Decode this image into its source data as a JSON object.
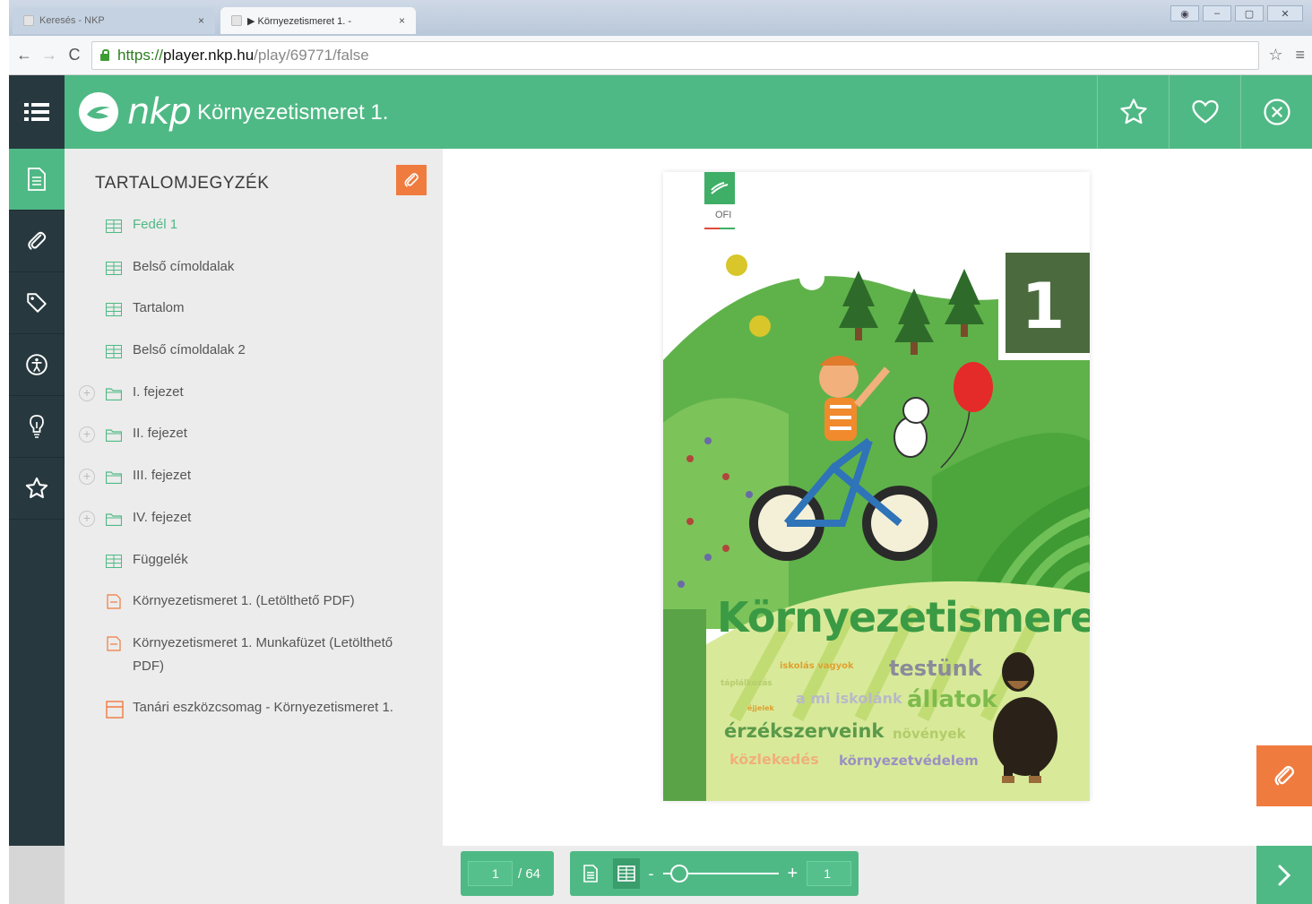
{
  "browser": {
    "tabs": [
      {
        "label": "Keresés - NKP",
        "active": false
      },
      {
        "label": "▶ Környezetismeret 1. - ",
        "active": true
      }
    ],
    "url": {
      "scheme": "https://",
      "host": "player.nkp.hu",
      "path": "/play/69771/false"
    }
  },
  "header": {
    "logo_text": "nkp",
    "title": "Környezetismeret 1.",
    "icons": [
      "star-icon",
      "heart-icon",
      "close-circle-icon"
    ]
  },
  "rail": {
    "items": [
      {
        "name": "document-icon",
        "active": true
      },
      {
        "name": "paperclip-icon",
        "active": false
      },
      {
        "name": "tag-icon",
        "active": false
      },
      {
        "name": "accessibility-icon",
        "active": false
      },
      {
        "name": "lightbulb-icon",
        "active": false
      },
      {
        "name": "star-icon",
        "active": false
      }
    ]
  },
  "toc": {
    "title": "TARTALOMJEGYZÉK",
    "items": [
      {
        "label": "Fedél 1",
        "icon": "grid-page-icon",
        "expandable": false,
        "highlight": true
      },
      {
        "label": "Belső címoldalak",
        "icon": "grid-page-icon",
        "expandable": false
      },
      {
        "label": "Tartalom",
        "icon": "grid-page-icon",
        "expandable": false
      },
      {
        "label": "Belső címoldalak 2",
        "icon": "grid-page-icon",
        "expandable": false
      },
      {
        "label": "I. fejezet",
        "icon": "folder-icon",
        "expandable": true
      },
      {
        "label": "II. fejezet",
        "icon": "folder-icon",
        "expandable": true
      },
      {
        "label": "III. fejezet",
        "icon": "folder-icon",
        "expandable": true
      },
      {
        "label": "IV. fejezet",
        "icon": "folder-icon",
        "expandable": true
      },
      {
        "label": "Függelék",
        "icon": "grid-page-icon",
        "expandable": false
      },
      {
        "label": "Környezetismeret 1. (Letölthető PDF)",
        "icon": "pdf-icon",
        "expandable": false
      },
      {
        "label": "Környezetismeret 1. Munkafüzet (Letölthető PDF)",
        "icon": "pdf-icon",
        "expandable": false
      },
      {
        "label": "Tanári eszközcsomag - Környezetismeret 1.",
        "icon": "package-icon",
        "expandable": false
      }
    ]
  },
  "cover": {
    "publisher": "OFI",
    "number": "1",
    "title": "Környezetismeret",
    "words": [
      "iskolás vagyok",
      "testünk",
      "táplálkozás",
      "a mi iskolánk",
      "állatok",
      "éjjelek",
      "érzékszerveink",
      "növények",
      "közlekedés",
      "környezetvédelem"
    ]
  },
  "toolbar": {
    "page_current": "1",
    "page_total": "/ 64",
    "zoom_minus": "-",
    "zoom_plus": "+",
    "zoom_value": "1"
  },
  "colors": {
    "brand_green": "#4fb985",
    "dark_rail": "#27393f",
    "accent_orange": "#f07b3f"
  }
}
